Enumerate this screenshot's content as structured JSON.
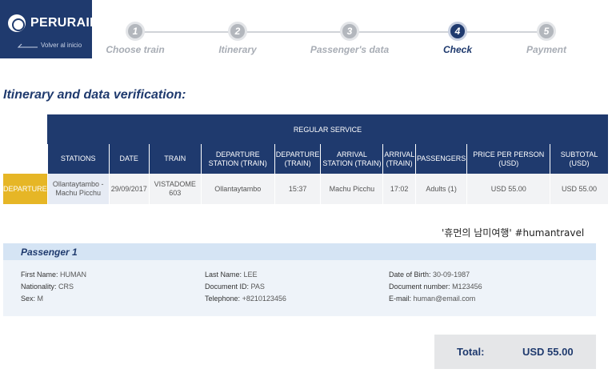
{
  "brand": {
    "name": "PERURAIL",
    "back_label": "Volver al inicio"
  },
  "steps": [
    {
      "number": "1",
      "label": "Choose train",
      "active": false
    },
    {
      "number": "2",
      "label": "Itinerary",
      "active": false
    },
    {
      "number": "3",
      "label": "Passenger's data",
      "active": false
    },
    {
      "number": "4",
      "label": "Check",
      "active": true
    },
    {
      "number": "5",
      "label": "Payment",
      "active": false
    }
  ],
  "section_title": "Itinerary and data verification:",
  "itinerary": {
    "service": "REGULAR SERVICE",
    "columns": [
      "STATIONS",
      "DATE",
      "TRAIN",
      "DEPARTURE STATION (TRAIN)",
      "DEPARTURE (TRAIN)",
      "ARRIVAL STATION (TRAIN)",
      "ARRIVAL (TRAIN)",
      "PASSENGERS",
      "PRICE PER PERSON (USD)",
      "SUBTOTAL (USD)"
    ],
    "row_label": "DEPARTURE",
    "row": [
      "Ollantaytambo - Machu Picchu",
      "29/09/2017",
      "VISTADOME 603",
      "Ollantaytambo",
      "15:37",
      "Machu Picchu",
      "17:02",
      "Adults (1)",
      "USD 55.00",
      "USD 55.00"
    ]
  },
  "watermark": "'휴먼의 남미여행' #humantravel",
  "passenger": {
    "title": "Passenger 1",
    "fields": {
      "first_name_label": "First Name:",
      "first_name": "HUMAN",
      "nationality_label": "Nationality:",
      "nationality": "CRS",
      "sex_label": "Sex:",
      "sex": "M",
      "last_name_label": "Last Name:",
      "last_name": "LEE",
      "document_id_label": "Document ID:",
      "document_id": "PAS",
      "telephone_label": "Telephone:",
      "telephone": "+8210123456",
      "dob_label": "Date of Birth:",
      "dob": "30-09-1987",
      "document_number_label": "Document number:",
      "document_number": "M123456",
      "email_label": "E-mail:",
      "email": "human@email.com"
    }
  },
  "total": {
    "label": "Total:",
    "value": "USD 55.00"
  },
  "colors": {
    "navy": "#1f3a6e",
    "gold": "#e6b626",
    "step_inactive": "#b3b7bd"
  }
}
